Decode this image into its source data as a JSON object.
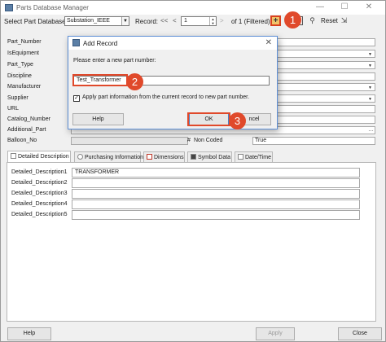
{
  "window": {
    "title": "Parts Database Manager"
  },
  "toolbar": {
    "db_label": "Select Part Database:",
    "db_value": "Substation_IEEE",
    "record_label": "Record:",
    "nav_first": "<<",
    "nav_prev": "<",
    "record_value": "1",
    "record_of": "of 1 (Filtered)",
    "add_symbol": "+",
    "reset_label": "Reset"
  },
  "fields": [
    {
      "label": "Part_Number",
      "value": ""
    },
    {
      "label": "IsEquipment",
      "value": ""
    },
    {
      "label": "Part_Type",
      "value": ""
    },
    {
      "label": "Discipline",
      "value": ""
    },
    {
      "label": "Manufacturer",
      "value": ""
    },
    {
      "label": "Supplier",
      "value": ""
    },
    {
      "label": "URL",
      "value": ""
    },
    {
      "label": "Catalog_Number",
      "value": ""
    },
    {
      "label": "Additional_Part",
      "value": ""
    },
    {
      "label": "Balloon_No",
      "value": ""
    }
  ],
  "balloon_row": {
    "hash": "#",
    "non_coded_label": "Non Coded",
    "non_coded_value": "True"
  },
  "tabs": [
    {
      "label": "Detailed Description",
      "active": true
    },
    {
      "label": "Purchasing Information",
      "active": false
    },
    {
      "label": "Dimensions",
      "active": false
    },
    {
      "label": "Symbol Data",
      "active": false
    },
    {
      "label": "Date/Time",
      "active": false
    }
  ],
  "descriptions": [
    {
      "label": "Detailed_Description1",
      "value": "TRANSFORMER"
    },
    {
      "label": "Detailed_Description2",
      "value": ""
    },
    {
      "label": "Detailed_Description3",
      "value": ""
    },
    {
      "label": "Detailed_Description4",
      "value": ""
    },
    {
      "label": "Detailed_Description5",
      "value": ""
    }
  ],
  "footer": {
    "help_label": "Help",
    "apply_label": "Apply",
    "close_label": "Close"
  },
  "dialog": {
    "title": "Add Record",
    "prompt": "Please enter a new part number:",
    "input_value": "Test_Transformer",
    "checkbox_label": "Apply part information from the current record to new part number.",
    "checkbox_checked": "✓",
    "help_label": "Help",
    "ok_label": "OK",
    "cancel_label": "ncel"
  },
  "callouts": [
    "1",
    "2",
    "3"
  ],
  "colors": {
    "callout": "#e0492b",
    "dialog_border": "#5d8fd6",
    "add_button_fill": "#f0c36a"
  }
}
